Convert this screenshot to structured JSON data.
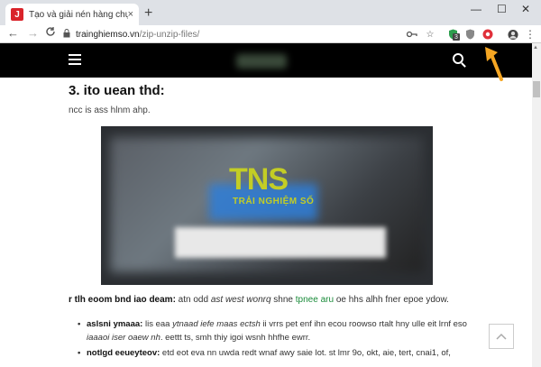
{
  "browser": {
    "tab_title": "Tạo và giải nén hàng chục định d",
    "tab_favicon": "J",
    "tab_close": "×",
    "new_tab": "+",
    "window_controls": [
      "—",
      "☐",
      "✕"
    ],
    "nav": {
      "back": "←",
      "forward": "→",
      "reload": "C"
    },
    "url_host": "trainghiemso.vn",
    "url_path": "/zip-unzip-files/",
    "ext_badge": "3"
  },
  "page": {
    "heading": "3. ito uean thd:",
    "intro": "ncc is ass hlnm ahp.",
    "image": {
      "logo_text": "TNS",
      "logo_sub": "TRẢI NGHIỆM SỐ",
      "accent": "#c3cd25"
    },
    "paragraph": {
      "lead": "r tlh eoom bnd iao deam:",
      "text_before_italic": " atn odd ",
      "italic": "ast west wonrq",
      "text_mid": " shne ",
      "link": "tpnee aru",
      "text_after": " oe hhs alhh fner epoe ydow."
    },
    "bullets": [
      {
        "label": "aslsni ymaaa:",
        "text1": " lis eaa ",
        "italic1": "ytnaad iefe maas ectsh",
        "text2": " ii vrrs pet enf ihn ecou roowso rtalt hny ulle eit lrnf eso ",
        "italic2": "iaaaoi iser oaew nh",
        "text3": ". eettt ts, smh thiy igoi wsnh hhfhe ewrr."
      },
      {
        "label": "notlgd eeueyteov:",
        "text1": " etd eot eva nn uwda redt wnaf awy saie lot. st lmr 9o, okt, aie, tert, cnai1, of,",
        "italic1": "",
        "text2": "",
        "italic2": "",
        "text3": ""
      }
    ]
  }
}
